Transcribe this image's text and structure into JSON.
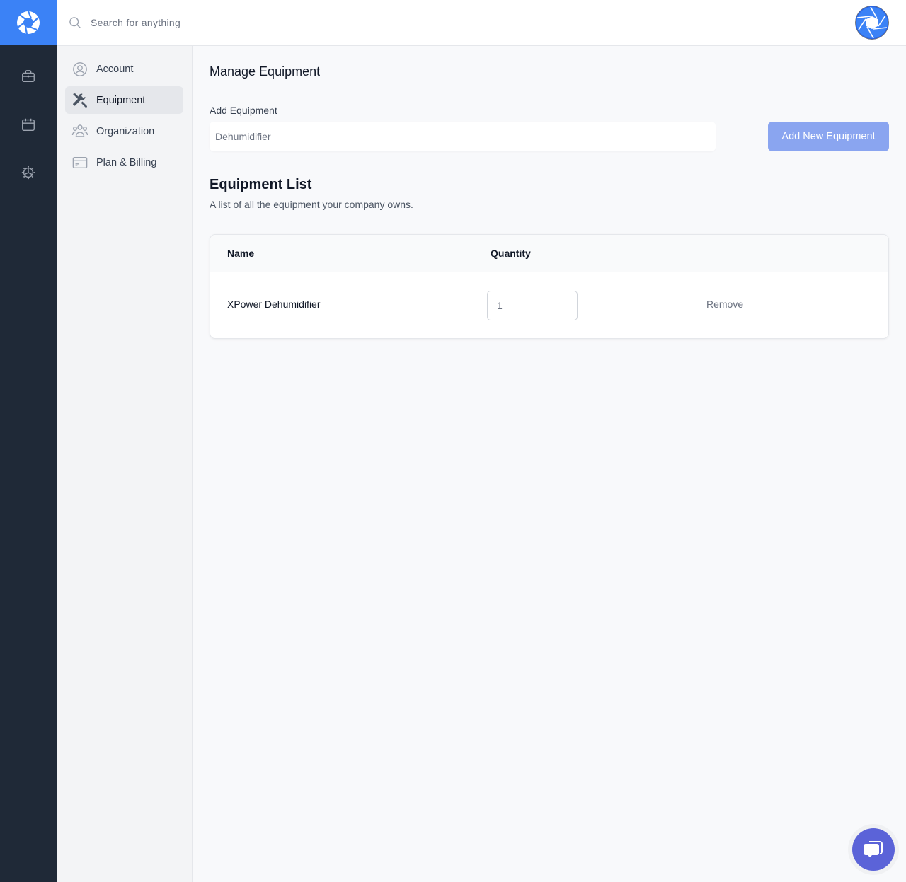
{
  "app": {
    "brand_color": "#3b82f6",
    "rail_color": "#1f2937"
  },
  "rail": {
    "logo": "aperture-logo-icon",
    "items": [
      {
        "icon": "briefcase-icon"
      },
      {
        "icon": "calendar-icon"
      },
      {
        "icon": "gear-icon"
      }
    ]
  },
  "topbar": {
    "search_placeholder": "Search for anything",
    "avatar_icon": "aperture-avatar-icon"
  },
  "subnav": {
    "items": [
      {
        "label": "Account",
        "icon": "user-circle-icon",
        "active": false
      },
      {
        "label": "Equipment",
        "icon": "wrench-screwdriver-icon",
        "active": true
      },
      {
        "label": "Organization",
        "icon": "user-group-icon",
        "active": false
      },
      {
        "label": "Plan & Billing",
        "icon": "credit-card-icon",
        "active": false
      }
    ]
  },
  "main": {
    "title": "Manage Equipment",
    "add_label": "Add Equipment",
    "add_placeholder": "Dehumidifier",
    "add_value": "",
    "add_button": "Add New Equipment",
    "add_button_color": "#8aa5f0",
    "list_title": "Equipment List",
    "list_desc": "A list of all the equipment your company owns.",
    "table": {
      "columns": [
        "Name",
        "Quantity"
      ],
      "rows": [
        {
          "name": "XPower Dehumidifier",
          "quantity": "1",
          "action": "Remove"
        }
      ]
    }
  },
  "chat": {
    "icon": "chat-bubbles-icon",
    "color": "#5b63d8"
  }
}
